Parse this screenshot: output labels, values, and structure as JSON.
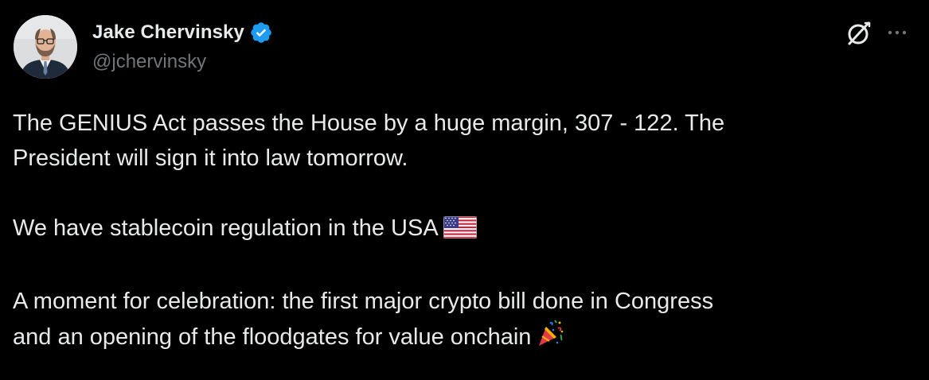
{
  "author": {
    "display_name": "Jake Chervinsky",
    "handle": "@jchervinsky",
    "verified_color": "#1d9bf0"
  },
  "icons": {
    "verified": "verified-badge-icon",
    "grok": "grok-icon",
    "more": "more-horizontal-icon"
  },
  "tweet": {
    "line1": "The GENIUS Act passes the House by a huge margin, 307 - 122. The",
    "line2": "President will sign it into law tomorrow.",
    "line3": "We have stablecoin regulation in the USA",
    "line4": "A moment for celebration: the first major crypto bill done in Congress",
    "line5": "and an opening of the floodgates for value onchain"
  },
  "emojis": {
    "flag": "us-flag-emoji",
    "party": "party-popper-emoji"
  },
  "colors": {
    "background": "#000000",
    "text": "#e7e9ea",
    "secondary": "#71767b"
  }
}
